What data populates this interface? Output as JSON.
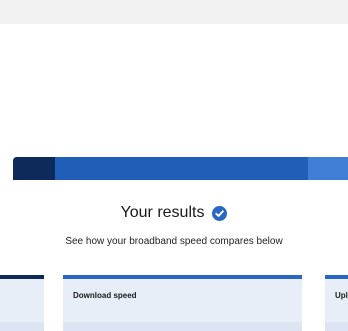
{
  "results": {
    "title": "Your results",
    "subtitle": "See how your broadband speed compares below"
  },
  "cards": {
    "download_label": "Download speed",
    "upload_label_partial": "Upl"
  },
  "colors": {
    "accent": "#2a66c4",
    "dark_navy": "#0e2a5a",
    "card_bg": "#e8eef8",
    "top_band": "#f2f2f2"
  },
  "icons": {
    "verified": "check-circle-icon"
  }
}
